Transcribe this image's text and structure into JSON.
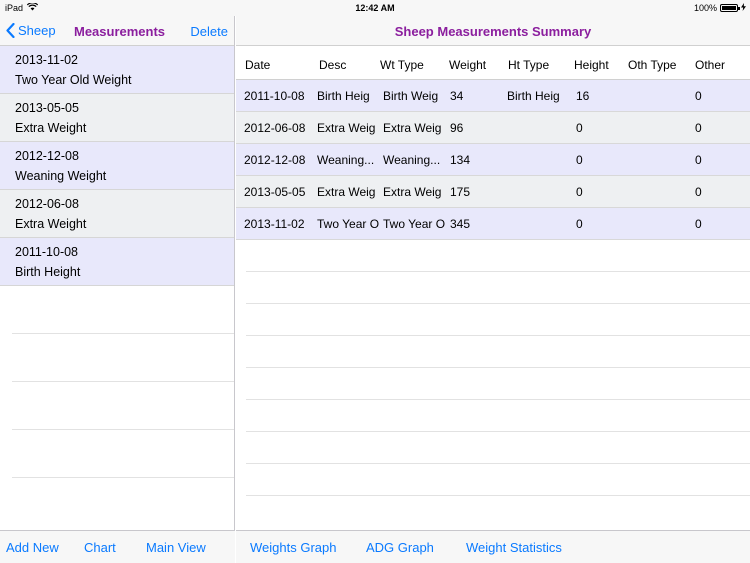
{
  "status_bar": {
    "device": "iPad",
    "time": "12:42 AM",
    "battery_text": "100%",
    "battery_level": 1.0
  },
  "master": {
    "back_label": "Sheep",
    "title": "Measurements",
    "delete_label": "Delete",
    "items": [
      {
        "date": "2013-11-02",
        "desc": "Two Year Old Weight"
      },
      {
        "date": "2013-05-05",
        "desc": "Extra Weight"
      },
      {
        "date": "2012-12-08",
        "desc": "Weaning Weight"
      },
      {
        "date": "2012-06-08",
        "desc": "Extra Weight"
      },
      {
        "date": "2011-10-08",
        "desc": "Birth Height"
      }
    ],
    "toolbar": {
      "add_new": "Add New",
      "chart": "Chart",
      "main_view": "Main View"
    }
  },
  "detail": {
    "title": "Sheep Measurements Summary",
    "columns": [
      "Date",
      "Desc",
      "Wt Type",
      "Weight",
      "Ht Type",
      "Height",
      "Oth Type",
      "Other"
    ],
    "rows": [
      [
        "2011-10-08",
        "Birth Heig",
        "Birth Weig",
        "34",
        "Birth Heig",
        "16",
        "",
        "0"
      ],
      [
        "2012-06-08",
        "Extra Weig",
        "Extra Weig",
        "96",
        "",
        "0",
        "",
        "0"
      ],
      [
        "2012-12-08",
        "Weaning...",
        "Weaning...",
        "134",
        "",
        "0",
        "",
        "0"
      ],
      [
        "2013-05-05",
        "Extra Weig",
        "Extra Weig",
        "175",
        "",
        "0",
        "",
        "0"
      ],
      [
        "2013-11-02",
        "Two Year O",
        "Two Year O",
        "345",
        "",
        "0",
        "",
        "0"
      ]
    ],
    "toolbar": {
      "weights_graph": "Weights Graph",
      "adg_graph": "ADG Graph",
      "weight_statistics": "Weight Statistics"
    }
  },
  "colors": {
    "accent_blue": "#0a7aff",
    "title_purple": "#8b1e9e",
    "row_lavender": "#e8e8fb",
    "row_gray": "#eef0f2"
  }
}
